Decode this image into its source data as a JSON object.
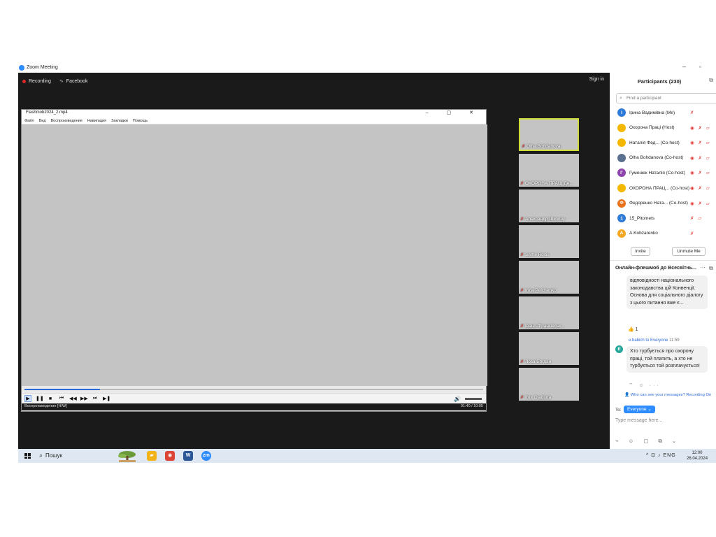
{
  "zoom": {
    "window_title": "Zoom Meeting",
    "minimize_glyph": "–",
    "maximize_glyph": "▫",
    "recording_label": "Recording",
    "livestream_label": "Facebook",
    "signin_label": "Sign in"
  },
  "player": {
    "file_title": "Flashmob2024_2.mp4",
    "window_controls": "– ▢ ✕",
    "menu": [
      "Файл",
      "Вид",
      "Воспроизведение",
      "Навигация",
      "Закладки",
      "Помощь"
    ],
    "progress_fraction": 0.165,
    "status_left": "Воспроизведение [H/W]",
    "status_right": "01:40 / 10:05",
    "controls": {
      "play": "▶",
      "pause": "❚❚",
      "stop": "■",
      "first": "⏮",
      "rewind": "◀◀",
      "forward": "▶▶",
      "last": "⏭",
      "frame": "▶❚",
      "volume": "🔊"
    }
  },
  "thumbnails": [
    {
      "name": "Olha Bohdanova"
    },
    {
      "name": "ОХОРОНА ПРАЦІ Дн..."
    },
    {
      "name": "Александр Школяр"
    },
    {
      "name": "Serhii Rosis"
    },
    {
      "name": "Irina Pelchenko"
    },
    {
      "name": "Івано-Франківськ..."
    },
    {
      "name": "Лоза Богдан"
    },
    {
      "name": "Ihor Diadiura"
    }
  ],
  "participants": {
    "title": "Participants (230)",
    "popout_icon": "⧉",
    "search_placeholder": "Find a participant",
    "search_icon": "⌕",
    "list": [
      {
        "name": "Ірина Вадимівна (Me)",
        "avatar": "І",
        "color": "#2d7ad8",
        "icons": "✗"
      },
      {
        "name": "Охорона Праці (Host)",
        "avatar": "",
        "color": "#f5b800",
        "icons": "◉ ✗ ▱"
      },
      {
        "name": "Наталія Фед... (Co-host)",
        "avatar": "",
        "color": "#f5b800",
        "icons": "◉ ✗ ▱"
      },
      {
        "name": "Olha Bohdanova (Co-host)",
        "avatar": "",
        "color": "#5b6f8f",
        "icons": "◉ ✗ ▱"
      },
      {
        "name": "Гуменюк Наталія (Co-host)",
        "avatar": "Г",
        "color": "#8e44ad",
        "icons": "◉ ✗ ▱"
      },
      {
        "name": "ОХОРОНА ПРАЦ... (Co-host)",
        "avatar": "",
        "color": "#f5b800",
        "icons": "◉ ✗ ▱"
      },
      {
        "name": "Федоренко Ната... (Co-host)",
        "avatar": "Ф",
        "color": "#e8711a",
        "icons": "◉ ✗ ▱"
      },
      {
        "name": "15_Pitomets",
        "avatar": "1",
        "color": "#2d7ad8",
        "icons": "✗ ▱"
      },
      {
        "name": "A.Kobzarenko",
        "avatar": "A",
        "color": "#f5a623",
        "icons": "✗"
      }
    ],
    "invite_label": "Invite",
    "unmute_me_label": "Unmute Me"
  },
  "chat": {
    "title": "Онлайн-флешмоб до Всесвітнь...",
    "more_icon": "···",
    "popout_icon": "⧉",
    "message_1": "відповідності національного законодавства цій Конвенції. Основа для соціального діалогу з цього питання вже є...",
    "reaction": "👍 1",
    "sender": "e.babich",
    "sender_to": "to Everyone",
    "sender_time": "11:59",
    "sender_initial": "E",
    "message_2": "Хто турбується про охорону праці, той платить, а хто не турбується той розплачується!",
    "message_tools": "⌔ ☺ ···",
    "privacy_line": "👤 Who can see your messages? Recording On",
    "to_label": "To:",
    "to_value": "Everyone ⌄",
    "input_placeholder": "Type message here...",
    "compose_tools": "⌁ ☺ ▢ ⧉ ⌄"
  },
  "taskbar": {
    "search_label": "Пошук",
    "search_icon": "⌕",
    "tray": "^ ⊡ ♪ ENG",
    "clock_time": "12:00",
    "clock_date": "26.04.2024",
    "apps": [
      {
        "name": "file-explorer",
        "glyph": "▰",
        "color": "#f2b21a"
      },
      {
        "name": "chrome",
        "glyph": "◉",
        "color": "#db4437"
      },
      {
        "name": "word",
        "glyph": "W",
        "color": "#2b5797"
      },
      {
        "name": "zoom",
        "glyph": "zm",
        "color": "#2d8cff"
      }
    ]
  }
}
